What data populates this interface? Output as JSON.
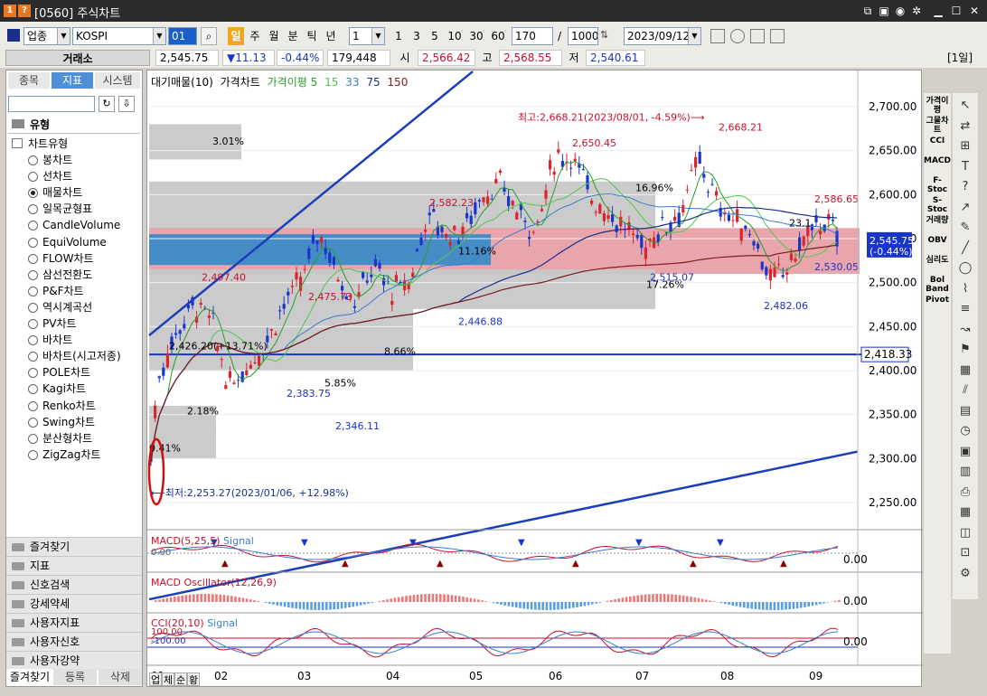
{
  "window": {
    "title": "[0560] 주식차트",
    "icons": [
      "chart-icon",
      "help-icon"
    ]
  },
  "toolbar": {
    "market": "업종",
    "symbol": "KOSPI",
    "code": "01",
    "periods": [
      "일",
      "주",
      "월",
      "분",
      "틱",
      "년"
    ],
    "active_period": "일",
    "unit_value": "1",
    "quick_units": [
      "1",
      "3",
      "5",
      "10",
      "30",
      "60"
    ],
    "count": "170",
    "total": "1000",
    "date": "2023/09/12"
  },
  "pricebar": {
    "exchange": "거래소",
    "price": "2,545.75",
    "change": "▼11.13",
    "change_pct": "-0.44%",
    "volume": "179,448",
    "open_label": "시",
    "open": "2,566.42",
    "high_label": "고",
    "high": "2,568.55",
    "low_label": "저",
    "low": "2,540.61",
    "period_tag": "[1일]"
  },
  "left_panel": {
    "tabs": [
      "종목",
      "지표",
      "시스템"
    ],
    "active_tab": "지표",
    "section": "유형",
    "tree_root": "차트유형",
    "chart_types": [
      "봉차트",
      "선차트",
      "매물차트",
      "일목균형표",
      "CandleVolume",
      "EquiVolume",
      "FLOW차트",
      "삼선전환도",
      "P&F차트",
      "역시계곡선",
      "PV차트",
      "바차트",
      "바차트(시고저종)",
      "POLE차트",
      "Kagi차트",
      "Renko차트",
      "Swing차트",
      "분산형차트",
      "ZigZag차트"
    ],
    "selected": "매물차트",
    "folders": [
      "즐겨찾기",
      "지표",
      "신호검색",
      "강세약세",
      "사용자지표",
      "사용자신호",
      "사용자강약"
    ],
    "bottom_tabs": [
      "즐겨찾기",
      "등록",
      "삭제"
    ]
  },
  "chart": {
    "legend": {
      "vol_profile": "대기매물(10)",
      "price": "가격차트",
      "ma_label": "가격이평",
      "ma": [
        "5",
        "15",
        "33",
        "75",
        "150"
      ]
    },
    "ma_colors": [
      "#2a9d2a",
      "#4ec94e",
      "#3a7cd1",
      "#1a2f8a",
      "#7a1c1c"
    ],
    "price_axis": [
      "2,700.00",
      "2,650.00",
      "2,600.00",
      "2,550.00",
      "2,500.00",
      "2,450.00",
      "2,400.00",
      "2,350.00",
      "2,300.00",
      "2,250.00"
    ],
    "current_price": "2,545.75",
    "current_pct": "(-0.44%)",
    "hline_value": "2,418.33",
    "annotations": {
      "high": "최고:2,668.21(2023/08/01, -4.59%)⟶",
      "low": "⟵최저:2,253.27(2023/01/06, +12.98%)",
      "peaks": [
        "2,497.40",
        "2,475.73",
        "2,582.23",
        "2,650.45",
        "2,668.21",
        "2,586.65"
      ],
      "troughs": [
        "2,426.20(+13.71%)",
        "2,383.75",
        "2,346.11",
        "2,446.88",
        "2,515.07",
        "2,482.06",
        "2,530.05"
      ],
      "profile_pct": [
        "3.01%",
        "16.96%",
        "11.16%",
        "17.26%",
        "8.66%",
        "5.85%",
        "2.18%",
        "0.41%",
        "23.1"
      ]
    },
    "months": [
      "01",
      "02",
      "03",
      "04",
      "05",
      "06",
      "07",
      "08",
      "09"
    ],
    "macd": {
      "label": "MACD(5,25,5)",
      "signal": "Signal",
      "value": "0.00",
      "zero": "0.00"
    },
    "osc": {
      "label": "MACD Oscillator(12,26,9)",
      "value": "0.00"
    },
    "cci": {
      "label": "CCI(20,10)",
      "signal": "Signal",
      "upper": "100.00",
      "lower": "-100.00",
      "value": "0.00"
    },
    "bottom_tabs": [
      "업",
      "체",
      "순",
      "황"
    ]
  },
  "right_tools": {
    "labels": [
      "가격이평",
      "그물차트",
      "CCI",
      "MACD",
      "F-Stoc",
      "S-Stoc",
      "거래량",
      "OBV",
      "심리도",
      "Bol Band",
      "Pivot"
    ]
  }
}
